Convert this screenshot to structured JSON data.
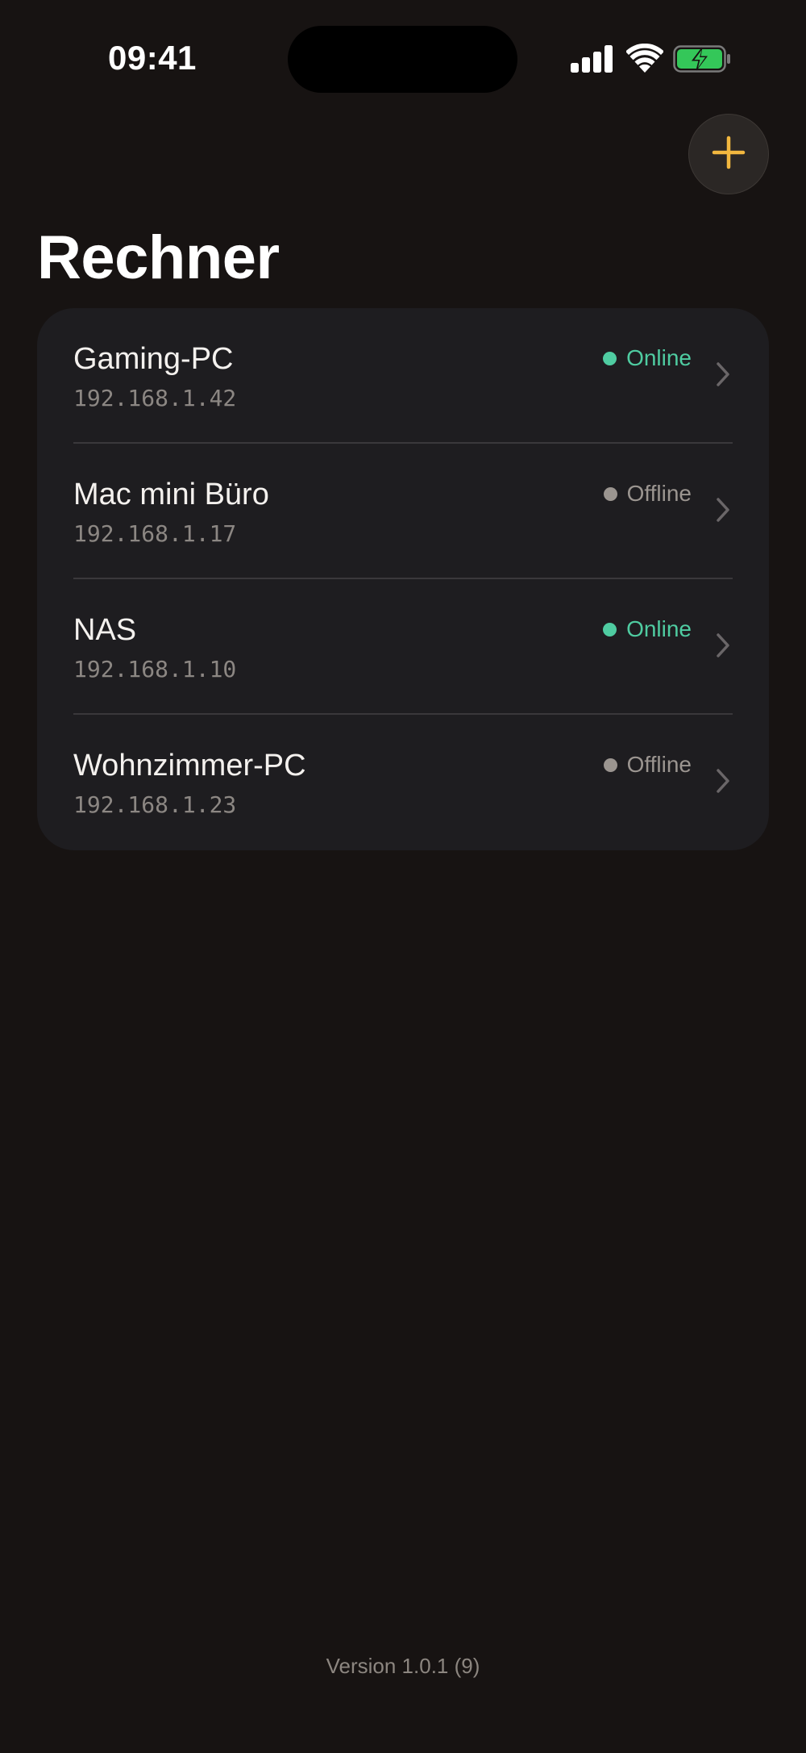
{
  "status_bar": {
    "time": "09:41",
    "icons": [
      "signal-icon",
      "wifi-icon",
      "battery-charging-icon"
    ],
    "battery_color": "#34c759"
  },
  "header": {
    "title": "Rechner",
    "add_button_icon": "plus-icon",
    "accent_color": "#f2b73f"
  },
  "devices": [
    {
      "name": "Gaming-PC",
      "ip": "192.168.1.42",
      "status": "Online",
      "online": true
    },
    {
      "name": "Mac mini Büro",
      "ip": "192.168.1.17",
      "status": "Offline",
      "online": false
    },
    {
      "name": "NAS",
      "ip": "192.168.1.10",
      "status": "Online",
      "online": true
    },
    {
      "name": "Wohnzimmer-PC",
      "ip": "192.168.1.23",
      "status": "Offline",
      "online": false
    }
  ],
  "colors": {
    "online": "#4fcca1",
    "offline": "#9b9590"
  },
  "footer": {
    "version": "Version 1.0.1 (9)"
  }
}
